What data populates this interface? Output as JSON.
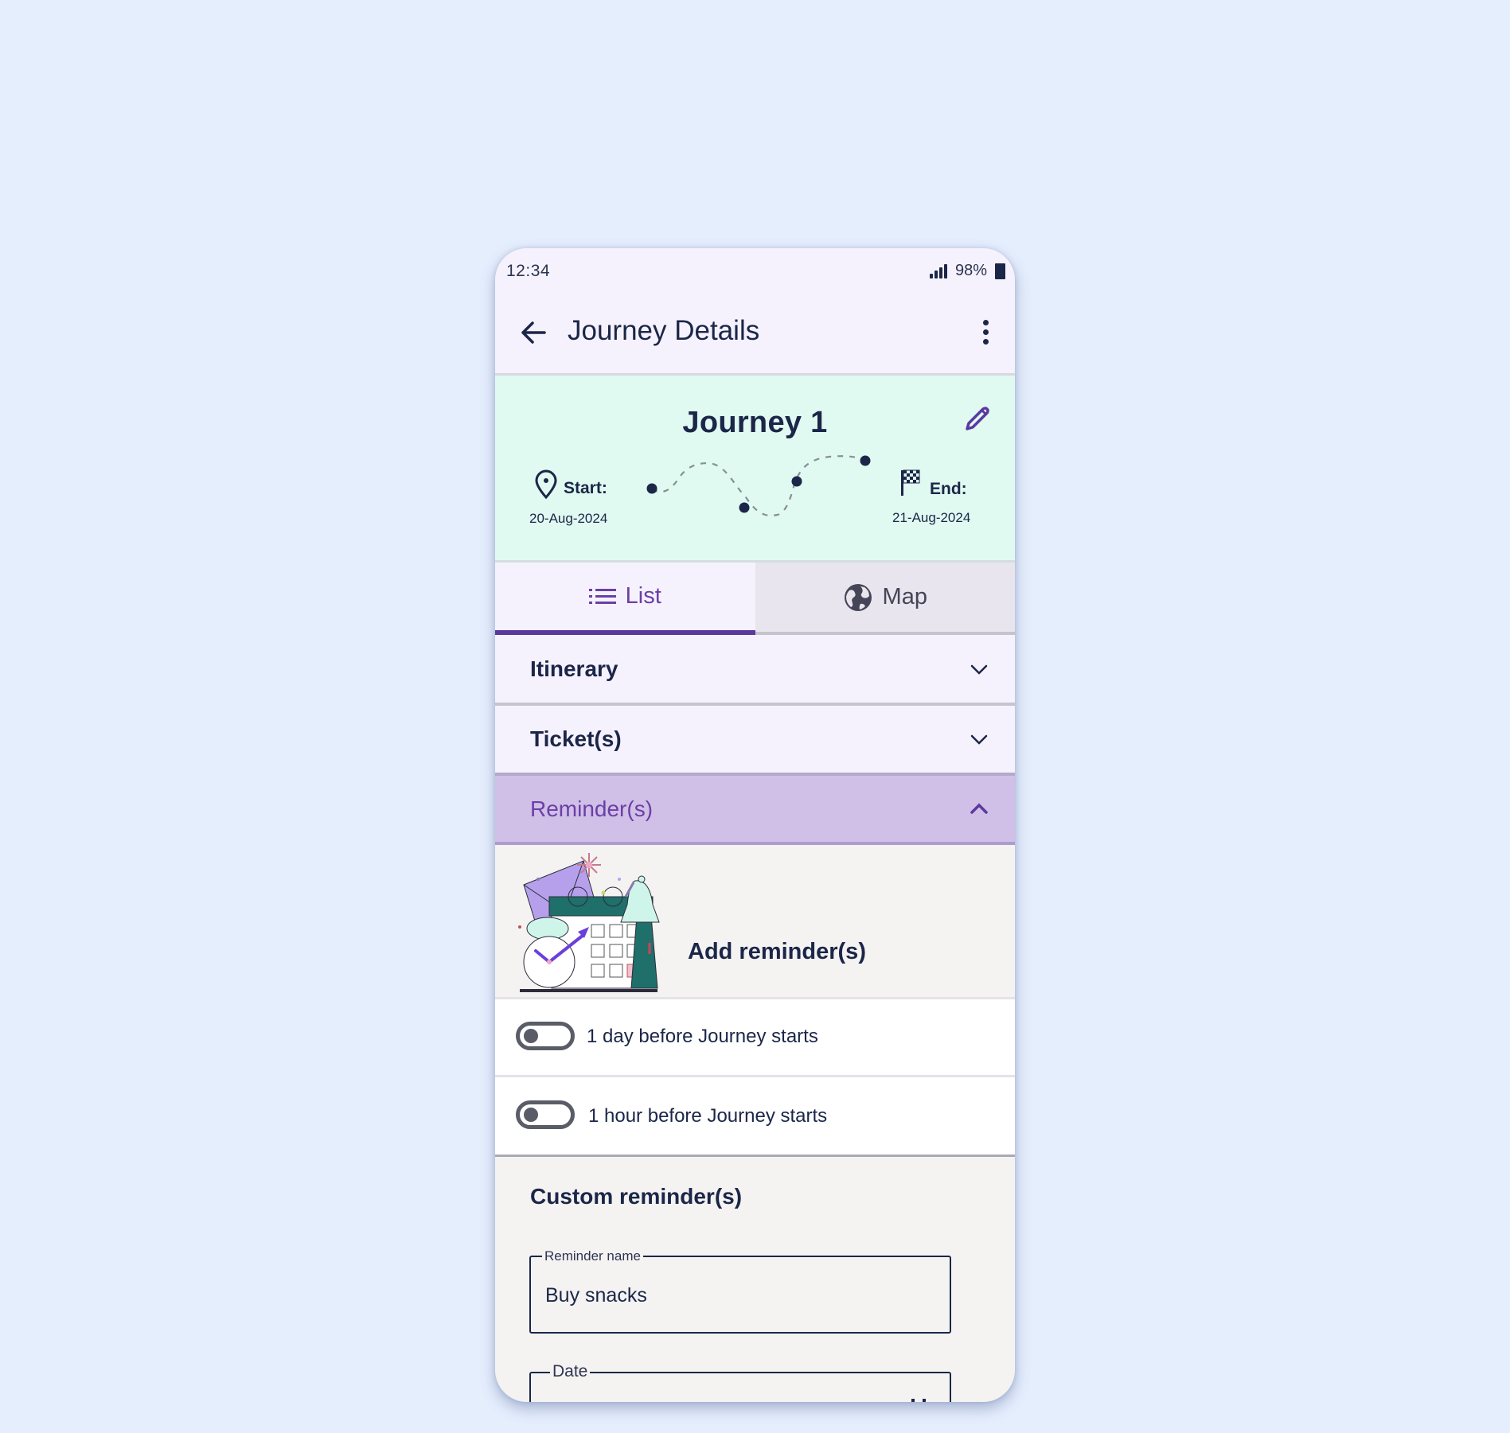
{
  "status_bar": {
    "time": "12:34",
    "battery_percent": "98%",
    "signal_icon": "signal-icon",
    "battery_icon": "battery-icon"
  },
  "app_bar": {
    "title": "Journey Details",
    "back_icon": "arrow-left-icon",
    "menu_icon": "more-vertical-icon"
  },
  "journey": {
    "name": "Journey 1",
    "edit_icon": "pencil-icon",
    "start_label": "Start:",
    "start_date": "20-Aug-2024",
    "end_label": "End:",
    "end_date": "21-Aug-2024",
    "route_stops": 4
  },
  "tabs": [
    {
      "label": "List",
      "icon": "list-icon",
      "active": true
    },
    {
      "label": "Map",
      "icon": "globe-icon",
      "active": false
    }
  ],
  "sections": [
    {
      "label": "Itinerary",
      "expanded": false
    },
    {
      "label": "Ticket(s)",
      "expanded": false
    },
    {
      "label": "Reminder(s)",
      "expanded": true
    }
  ],
  "reminders": {
    "add_label": "Add reminder(s)",
    "presets": [
      {
        "label": "1 day before Journey starts",
        "enabled": false
      },
      {
        "label": "1 hour before Journey starts",
        "enabled": false
      }
    ],
    "custom": {
      "title": "Custom reminder(s)",
      "name_label": "Reminder name",
      "name_value": "Buy snacks",
      "date_label": "Date",
      "date_value": ""
    }
  },
  "colors": {
    "accent": "#5B38A0",
    "card_bg": "#E0FAF1",
    "expanded_header_bg": "#D0BFE6",
    "text": "#1B2648",
    "page_bg": "#E5EEFD"
  }
}
